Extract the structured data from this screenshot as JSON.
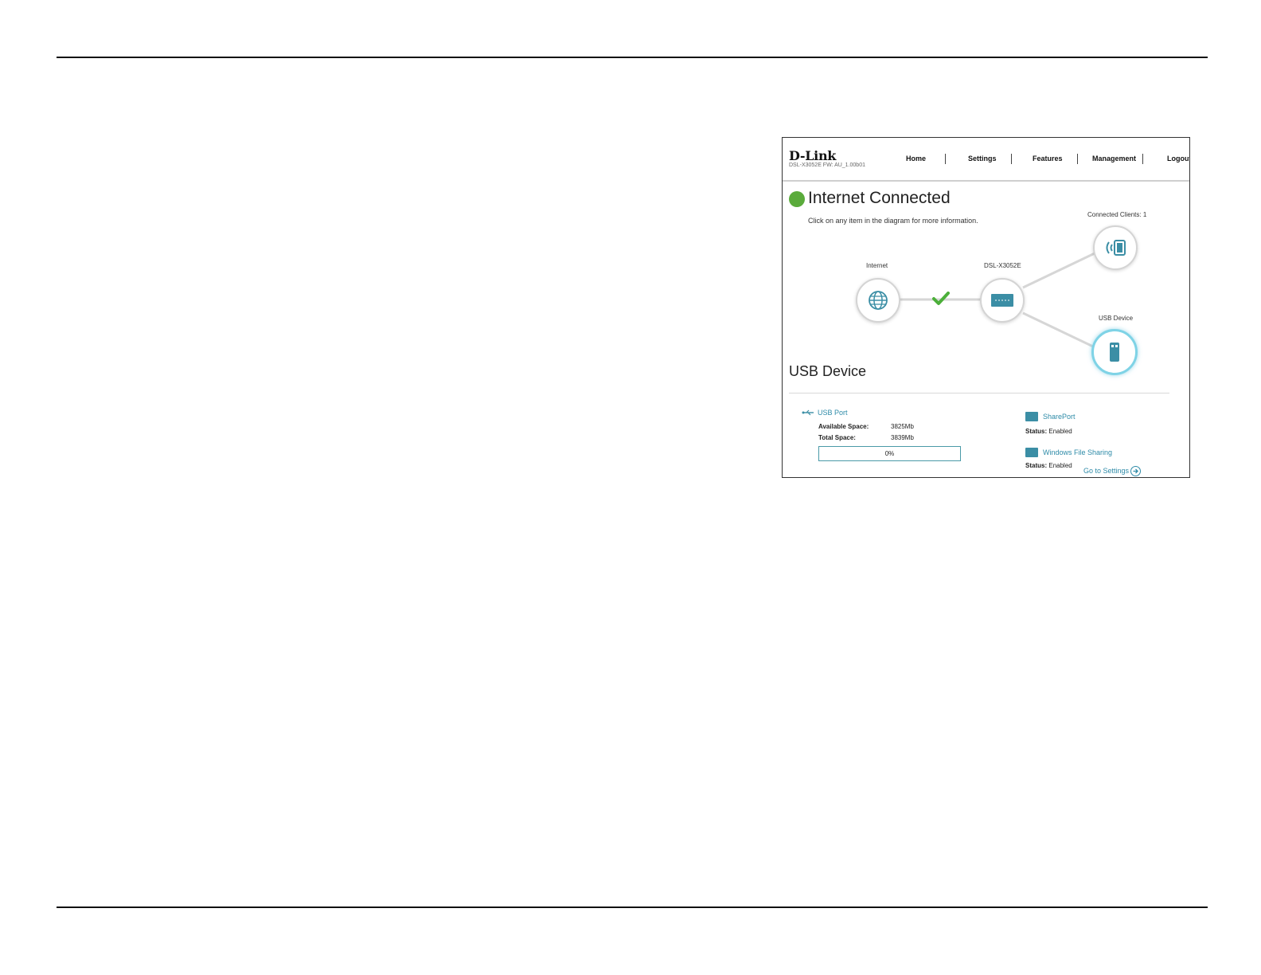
{
  "header": {
    "logo": "D-Link",
    "firmware": "DSL-X3052E   FW: AU_1.00b01",
    "nav": [
      {
        "label": "Home"
      },
      {
        "label": "Settings"
      },
      {
        "label": "Features"
      },
      {
        "label": "Management"
      },
      {
        "label": "Logout"
      }
    ]
  },
  "status": {
    "title": "Internet Connected",
    "hint": "Click on any item in the diagram for more information.",
    "color": "#5aab3b"
  },
  "diagram": {
    "internet_label": "Internet",
    "router_label": "DSL-X3052E",
    "clients_label": "Connected Clients: 1",
    "usb_label": "USB Device",
    "icons": [
      "globe-icon",
      "check-icon",
      "router-icon",
      "wireless-client-icon",
      "usb-stick-icon"
    ]
  },
  "usb": {
    "section_title": "USB Device",
    "port_label": "USB Port",
    "available_label": "Available Space:",
    "available_value": "3825Mb",
    "total_label": "Total Space:",
    "total_value": "3839Mb",
    "usage_percent": 0,
    "usage_text": "0%"
  },
  "services": {
    "shareport_title": "SharePort",
    "shareport_status_label": "Status:",
    "shareport_status_value": "Enabled",
    "wfs_title": "Windows File Sharing",
    "wfs_status_label": "Status:",
    "wfs_status_value": "Enabled",
    "go_settings": "Go to Settings"
  },
  "accent_color": "#2e8ba8"
}
